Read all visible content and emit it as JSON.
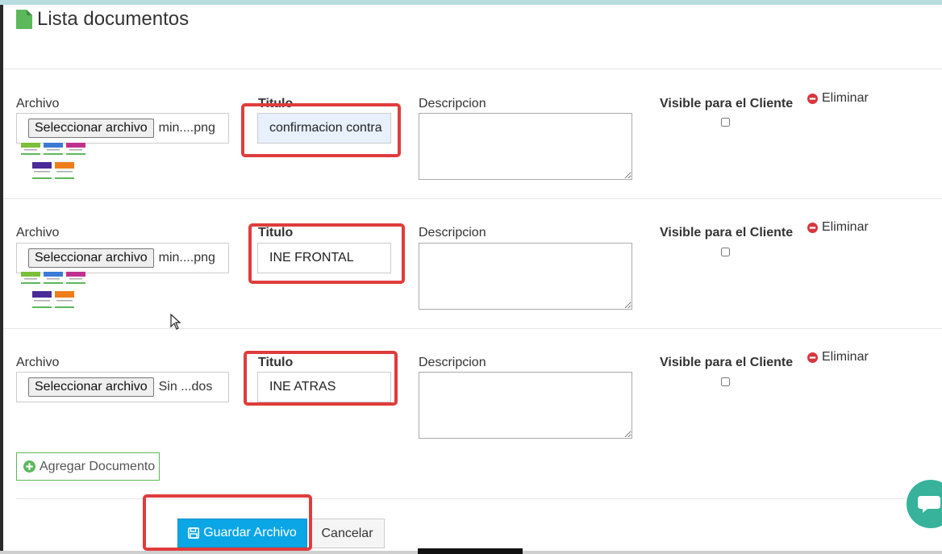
{
  "header": {
    "title": "Lista documentos",
    "icon": "file-icon",
    "icon_color": "#5cb85c"
  },
  "labels": {
    "archivo": "Archivo",
    "titulo": "Titulo",
    "descripcion": "Descripcion",
    "visible": "Visible para el Cliente",
    "eliminar": "Eliminar",
    "select_file": "Seleccionar archivo"
  },
  "documents": [
    {
      "file_name": "min....png",
      "title": "confirmacion contra",
      "description": "",
      "visible": false,
      "has_thumbnail": true
    },
    {
      "file_name": "min....png",
      "title": "INE FRONTAL",
      "description": "",
      "visible": false,
      "has_thumbnail": true
    },
    {
      "file_name": "Sin ...dos",
      "title": "INE ATRAS",
      "description": "",
      "visible": false,
      "has_thumbnail": false
    }
  ],
  "actions": {
    "add_document": "Agregar Documento",
    "save": "Guardar Archivo",
    "cancel": "Cancelar"
  },
  "colors": {
    "primary": "#0aa6e6",
    "success": "#5cb85c",
    "danger": "#d9363e",
    "highlight": "#e03c3c",
    "chat": "#36b39a"
  }
}
